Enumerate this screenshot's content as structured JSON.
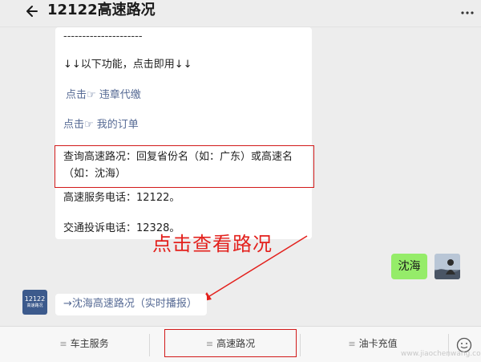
{
  "header": {
    "title": "12122高速路况",
    "back_icon": "arrow-left-icon",
    "more_icon": "ellipsis-icon"
  },
  "message": {
    "divider": "---------------------",
    "intro": "↓↓以下功能，点击即用↓↓",
    "link_violation": "点击☞ 违章代缴",
    "link_orders": "点击☞ 我的订单",
    "query_tip": "查询高速路况：回复省份名（如：广东）或高速名（如：沈海）",
    "service_phone": "高速服务电话：12122。",
    "complaint_phone": "交通投诉电话：12328。"
  },
  "annotation": {
    "text": "点击查看路况",
    "color": "#e3201c"
  },
  "user_message": {
    "text": "沈海"
  },
  "bot_card": {
    "avatar_number": "12122",
    "avatar_caption": "高速路况",
    "link_text": "→沈海高速路况（实时播报）"
  },
  "bottom_menu": {
    "items": [
      "车主服务",
      "高速路况",
      "油卡充值"
    ],
    "keyboard_icon": "keyboard-icon"
  },
  "watermark": "www.jiaochenwang.com",
  "colors": {
    "highlight": "#d21a1a",
    "link": "#576b95",
    "user_bubble": "#95ec69"
  }
}
